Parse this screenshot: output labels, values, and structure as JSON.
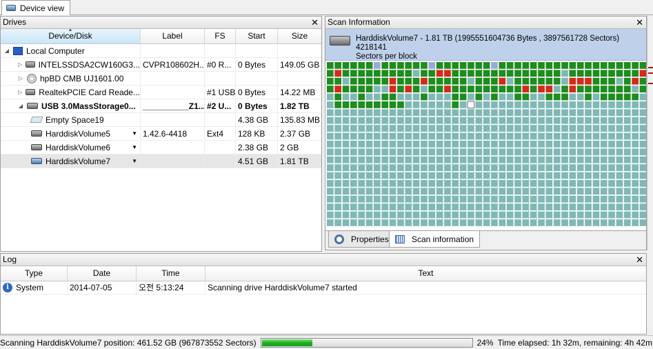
{
  "top_tab": {
    "label": "Device view"
  },
  "drives_panel": {
    "title": "Drives",
    "close": "✕",
    "columns": [
      "Device/Disk",
      "Label",
      "FS",
      "Start",
      "Size"
    ],
    "rows": [
      {
        "name": "Local Computer",
        "label": "",
        "fs": "",
        "start": "",
        "size": ""
      },
      {
        "name": "INTELSSDSA2CW160G3...",
        "label": "CVPR108602H...",
        "fs": "#0 R...",
        "start": "0 Bytes",
        "size": "149.05 GB"
      },
      {
        "name": "hpBD CMB UJ1601.00",
        "label": "",
        "fs": "",
        "start": "",
        "size": ""
      },
      {
        "name": "RealtekPCIE Card Reade...",
        "label": "",
        "fs": "#1 USB",
        "start": "0 Bytes",
        "size": "14.22 MB"
      },
      {
        "name": "USB 3.0MassStorage0...",
        "label": "__________Z1...",
        "fs": "#2 U...",
        "start": "0 Bytes",
        "size": "1.82 TB"
      },
      {
        "name": "Empty Space19",
        "label": "",
        "fs": "",
        "start": "4.38 GB",
        "size": "135.83 MB"
      },
      {
        "name": "HarddiskVolume5",
        "label": "1.42.6-4418",
        "fs": "Ext4",
        "start": "128 KB",
        "size": "2.37 GB"
      },
      {
        "name": "HarddiskVolume6",
        "label": "",
        "fs": "",
        "start": "2.38 GB",
        "size": "2 GB"
      },
      {
        "name": "HarddiskVolume7",
        "label": "",
        "fs": "",
        "start": "4.51 GB",
        "size": "1.81 TB"
      }
    ]
  },
  "scan_panel": {
    "title": "Scan Information",
    "close": "✕",
    "header_line1": "HarddiskVolume7 - 1.81 TB (1995551604736 Bytes , 3897561728 Sectors) 4218141",
    "header_line2": "Sectors per block",
    "tabs": [
      "Properties",
      "Scan information"
    ],
    "colors": {
      "done": "#1e8c1e",
      "bad": "#d42a1a",
      "pending": "#7fb8b6",
      "marked": "#9aa8dc",
      "current": "#ffffff"
    }
  },
  "log_panel": {
    "title": "Log",
    "close": "✕",
    "columns": [
      "Type",
      "Date",
      "Time",
      "Text"
    ],
    "entries": [
      {
        "type": "System",
        "date": "2014-07-05",
        "time": "오전 5:13:24",
        "text": "Scanning drive HarddiskVolume7 started"
      }
    ]
  },
  "status_bar": {
    "position_text": "Scanning HarddiskVolume7 position: 461.52 GB (967873552 Sectors)",
    "progress": 0.24,
    "percent": "24%",
    "time_text": "Time elapsed: 1h 32m, remaining: 4h 42m"
  }
}
